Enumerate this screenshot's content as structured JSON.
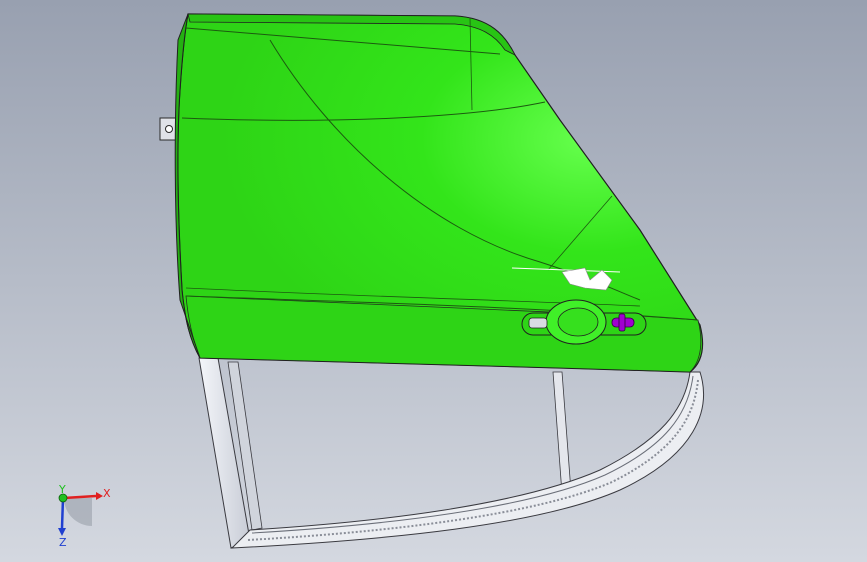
{
  "viewport": {
    "background_top": "#98a0b0",
    "background_bottom": "#d4d8e0"
  },
  "model": {
    "panel_color": "#33e51a",
    "panel_highlight": "#66ff4d",
    "panel_edge": "#1c5a10",
    "frame_color": "#e8eaf0",
    "frame_edge": "#3a3a40",
    "handle_accent": "#a000d0",
    "outline_color": "#202020"
  },
  "triad": {
    "x_label": "X",
    "y_label": "Y",
    "z_label": "Z",
    "x_color": "#e02020",
    "y_color": "#20c020",
    "z_color": "#2040d0"
  }
}
